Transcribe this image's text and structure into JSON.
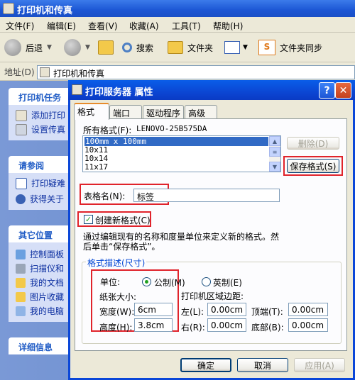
{
  "explorer": {
    "title": "打印机和传真",
    "menu": [
      "文件(F)",
      "编辑(E)",
      "查看(V)",
      "收藏(A)",
      "工具(T)",
      "帮助(H)"
    ],
    "toolbar": {
      "back": "后退",
      "search": "搜索",
      "folders": "文件夹",
      "sync": "文件夹同步"
    },
    "address_label": "地址(D)",
    "address_value": "打印机和传真"
  },
  "taskpane": {
    "printer_tasks": {
      "title": "打印机任务",
      "items": [
        "添加打印",
        "设置传真"
      ]
    },
    "see_also": {
      "title": "请参阅",
      "items": [
        "打印疑难",
        "获得关于"
      ]
    },
    "other_places": {
      "title": "其它位置",
      "items": [
        "控制面板",
        "扫描仪和",
        "我的文档",
        "图片收藏",
        "我的电脑"
      ]
    },
    "details": {
      "title": "详细信息"
    }
  },
  "dialog": {
    "title": "打印服务器 属性",
    "help_btn": "?",
    "close_btn": "✕",
    "tabs": [
      "格式",
      "端口",
      "驱动程序",
      "高级"
    ],
    "all_formats_label": "所有格式(F):",
    "server_name": "LENOVO-25B575DA",
    "formats": [
      "100mm x 100mm",
      "10x11",
      "10x14",
      "11x17"
    ],
    "delete_btn": "删除(D)",
    "save_btn": "保存格式(S)",
    "form_name_label": "表格名(N):",
    "form_name_value": "标签",
    "create_new_label": "创建新格式(C)",
    "create_new_checked": true,
    "info_text_1": "通过编辑现有的名称和度量单位来定义新的格式。然",
    "info_text_2": "后单击“保存格式”。",
    "group_title": "格式描述(尺寸)",
    "units_label": "单位:",
    "metric_label": "公制(M)",
    "english_label": "英制(E)",
    "paper_size_label": "纸张大小:",
    "margins_label": "打印机区域边距:",
    "width_label": "宽度(W):",
    "width_value": "6cm",
    "height_label": "高度(H):",
    "height_value": "3.8cm",
    "left_label": "左(L):",
    "left_value": "0.00cm",
    "right_label": "右(R):",
    "right_value": "0.00cm",
    "top_label": "顶端(T):",
    "top_value": "0.00cm",
    "bottom_label": "底部(B):",
    "bottom_value": "0.00cm",
    "ok_btn": "确定",
    "cancel_btn": "取消",
    "apply_btn": "应用(A)"
  }
}
